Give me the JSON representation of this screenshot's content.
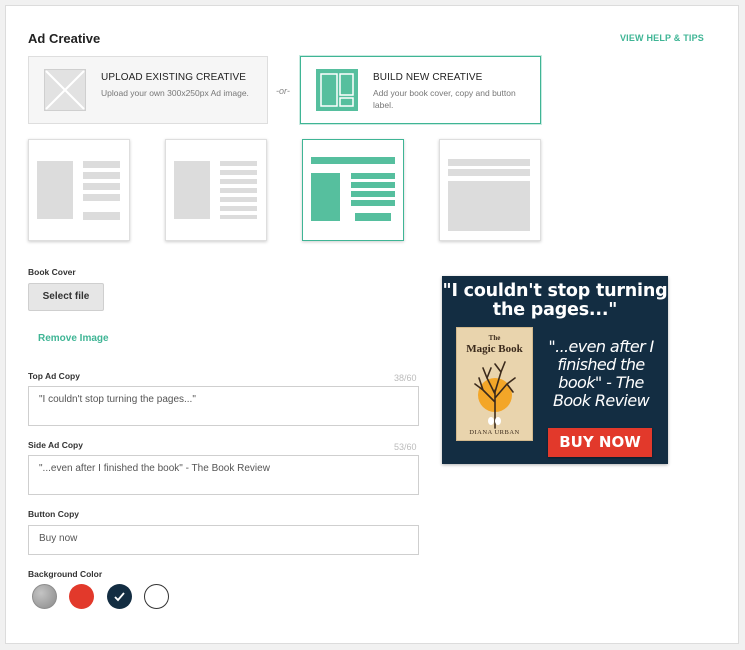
{
  "header": {
    "title": "Ad Creative",
    "help_link": "VIEW HELP & TIPS"
  },
  "creative_options": {
    "upload": {
      "title": "UPLOAD EXISTING CREATIVE",
      "description": "Upload your own 300x250px Ad image."
    },
    "separator": "-or-",
    "build": {
      "title": "BUILD NEW CREATIVE",
      "description": "Add your book cover, copy and button label.",
      "selected": true
    }
  },
  "layouts": {
    "items": [
      {
        "name": "layout-cover-left-text-right",
        "selected": false
      },
      {
        "name": "layout-cover-left-lines-right",
        "selected": false
      },
      {
        "name": "layout-banner-top-cover-left",
        "selected": true
      },
      {
        "name": "layout-banner-top-block",
        "selected": false
      }
    ]
  },
  "form": {
    "book_cover_label": "Book Cover",
    "select_file_label": "Select file",
    "remove_image_label": "Remove Image",
    "top_copy": {
      "label": "Top Ad Copy",
      "counter": "38/60",
      "value": "\"I couldn't stop turning the pages...\""
    },
    "side_copy": {
      "label": "Side Ad Copy",
      "counter": "53/60",
      "value": "\"...even after I finished the book\" - The Book Review"
    },
    "button_copy": {
      "label": "Button Copy",
      "value": "Buy now"
    },
    "background_color": {
      "label": "Background Color",
      "swatches": [
        {
          "name": "gray",
          "color": "#9a9a9a",
          "selected": false
        },
        {
          "name": "red",
          "color": "#e2392b",
          "selected": false
        },
        {
          "name": "navy",
          "color": "#132d42",
          "selected": true
        },
        {
          "name": "white",
          "color": "#ffffff",
          "selected": false
        }
      ]
    }
  },
  "preview": {
    "top_text": "\"I couldn't stop turning the pages...\"",
    "book_title_line1": "The",
    "book_title_line2": "Magic Book",
    "book_author": "DIANA URBAN",
    "side_text": "\"...even after I finished the book\" - The Book Review",
    "button_text": "BUY NOW",
    "background": "#132d42",
    "button_color": "#e2392b"
  },
  "colors": {
    "accent": "#3fb595"
  }
}
